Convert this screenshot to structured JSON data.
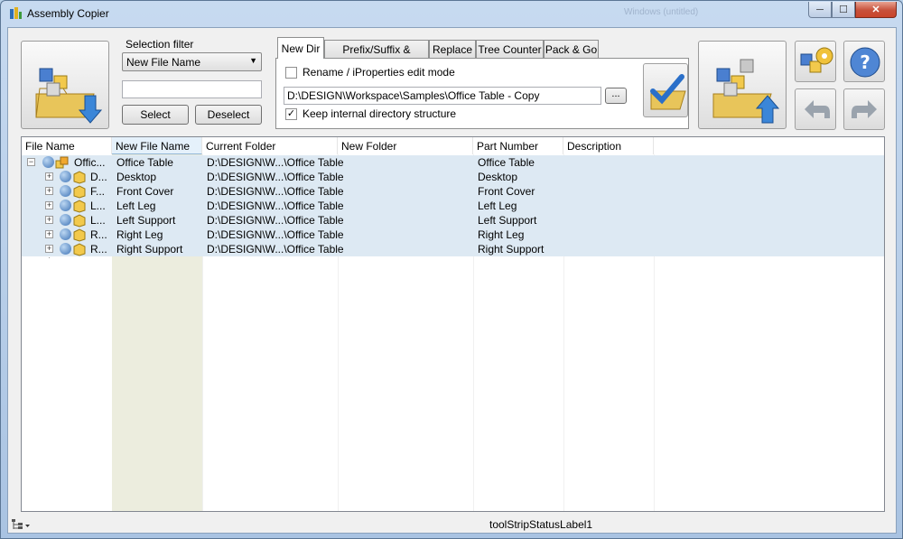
{
  "window": {
    "title": "Assembly Copier",
    "background_title": "Windows (untitled)",
    "controls": {
      "minimize": "─",
      "maximize": "☐",
      "close": "✕"
    }
  },
  "toolbar": {
    "selection_filter_label": "Selection filter",
    "filter_dropdown_value": "New File Name",
    "filter_input_value": "",
    "select_label": "Select",
    "deselect_label": "Deselect",
    "browse_label": "..."
  },
  "tabs": [
    {
      "label": "New Dir",
      "active": true
    },
    {
      "label": "Prefix/Suffix & Counter",
      "active": false
    },
    {
      "label": "Replace",
      "active": false
    },
    {
      "label": "Tree Counter",
      "active": false
    },
    {
      "label": "Pack & Go",
      "active": false
    }
  ],
  "new_dir_tab": {
    "rename_checkbox_label": "Rename / iProperties edit mode",
    "rename_checked": false,
    "path_value": "D:\\DESIGN\\Workspace\\Samples\\Office Table - Copy",
    "keep_structure_label": "Keep internal directory structure",
    "keep_structure_checked": true
  },
  "grid": {
    "columns": [
      "File Name",
      "New File Name",
      "Current Folder",
      "New Folder",
      "Part Number",
      "Description"
    ],
    "rows": [
      {
        "file_name": "Offic...",
        "new_file_name": "Office Table",
        "current_folder": "D:\\DESIGN\\W...\\Office Table",
        "new_folder": "",
        "part_number": "Office Table",
        "description": "",
        "kind": "assembly"
      },
      {
        "file_name": "D...",
        "new_file_name": "Desktop",
        "current_folder": "D:\\DESIGN\\W...\\Office Table",
        "new_folder": "",
        "part_number": "Desktop",
        "description": "",
        "kind": "part"
      },
      {
        "file_name": "F...",
        "new_file_name": "Front Cover",
        "current_folder": "D:\\DESIGN\\W...\\Office Table",
        "new_folder": "",
        "part_number": "Front Cover",
        "description": "",
        "kind": "part"
      },
      {
        "file_name": "L...",
        "new_file_name": "Left Leg",
        "current_folder": "D:\\DESIGN\\W...\\Office Table",
        "new_folder": "",
        "part_number": "Left Leg",
        "description": "",
        "kind": "part"
      },
      {
        "file_name": "L...",
        "new_file_name": "Left Support",
        "current_folder": "D:\\DESIGN\\W...\\Office Table",
        "new_folder": "",
        "part_number": "Left Support",
        "description": "",
        "kind": "part"
      },
      {
        "file_name": "R...",
        "new_file_name": "Right Leg",
        "current_folder": "D:\\DESIGN\\W...\\Office Table",
        "new_folder": "",
        "part_number": "Right Leg",
        "description": "",
        "kind": "part"
      },
      {
        "file_name": "R...",
        "new_file_name": "Right Support",
        "current_folder": "D:\\DESIGN\\W...\\Office Table",
        "new_folder": "",
        "part_number": "Right Support",
        "description": "",
        "kind": "part"
      }
    ]
  },
  "statusbar": {
    "label": "toolStripStatusLabel1"
  },
  "icons": {
    "open": "open-assembly-icon",
    "copy": "copy-assembly-icon",
    "apply": "apply-check-icon",
    "settings": "settings-icon",
    "help": "help-icon",
    "undo": "undo-icon",
    "redo": "redo-icon",
    "view_menu": "tree-view-icon"
  },
  "colors": {
    "accent": "#3d73b6",
    "row_highlight": "#dde9f3",
    "column_highlight": "#ecedde"
  }
}
